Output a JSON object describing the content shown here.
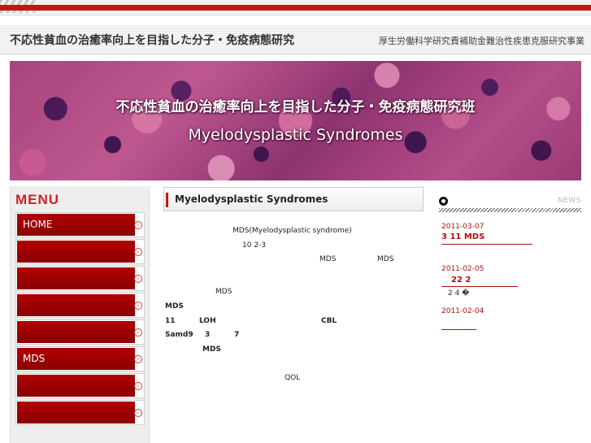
{
  "header": {
    "site_title": "不応性貧血の治癒率向上を目指した分子・免疫病態研究",
    "site_subtitle": "厚生労働科学研究費補助金難治性疾患克服研究事業"
  },
  "banner": {
    "title": "不応性貧血の治癒率向上を目指した分子・免疫病態研究班",
    "subtitle": "Myelodysplastic Syndromes"
  },
  "menu": {
    "heading": "MENU",
    "items": [
      {
        "label": "HOME"
      },
      {
        "label": ""
      },
      {
        "label": ""
      },
      {
        "label": ""
      },
      {
        "label": ""
      },
      {
        "label": "MDS"
      },
      {
        "label": ""
      },
      {
        "label": ""
      }
    ]
  },
  "content": {
    "heading": "Myelodysplastic Syndromes",
    "lines": [
      "MDS(Myelodysplastic  syndrome)",
      "10    2-3",
      "MDS",
      "MDS",
      "MDS",
      "MDS",
      "11",
      "LOH",
      "CBL",
      "Samd9",
      "3",
      "7",
      "MDS",
      "QOL"
    ]
  },
  "news": {
    "label": "NEWS",
    "items": [
      {
        "date": "2011-03-07",
        "title": "3  11  MDS"
      },
      {
        "date": "2011-02-05",
        "title": "22     2",
        "note": "2 4                     �"
      },
      {
        "date": "2011-02-04",
        "title": ""
      }
    ]
  },
  "colors": {
    "accent_red": "#c41414",
    "menu_red": "#b00000",
    "menu_heading_red": "#d2202a"
  }
}
